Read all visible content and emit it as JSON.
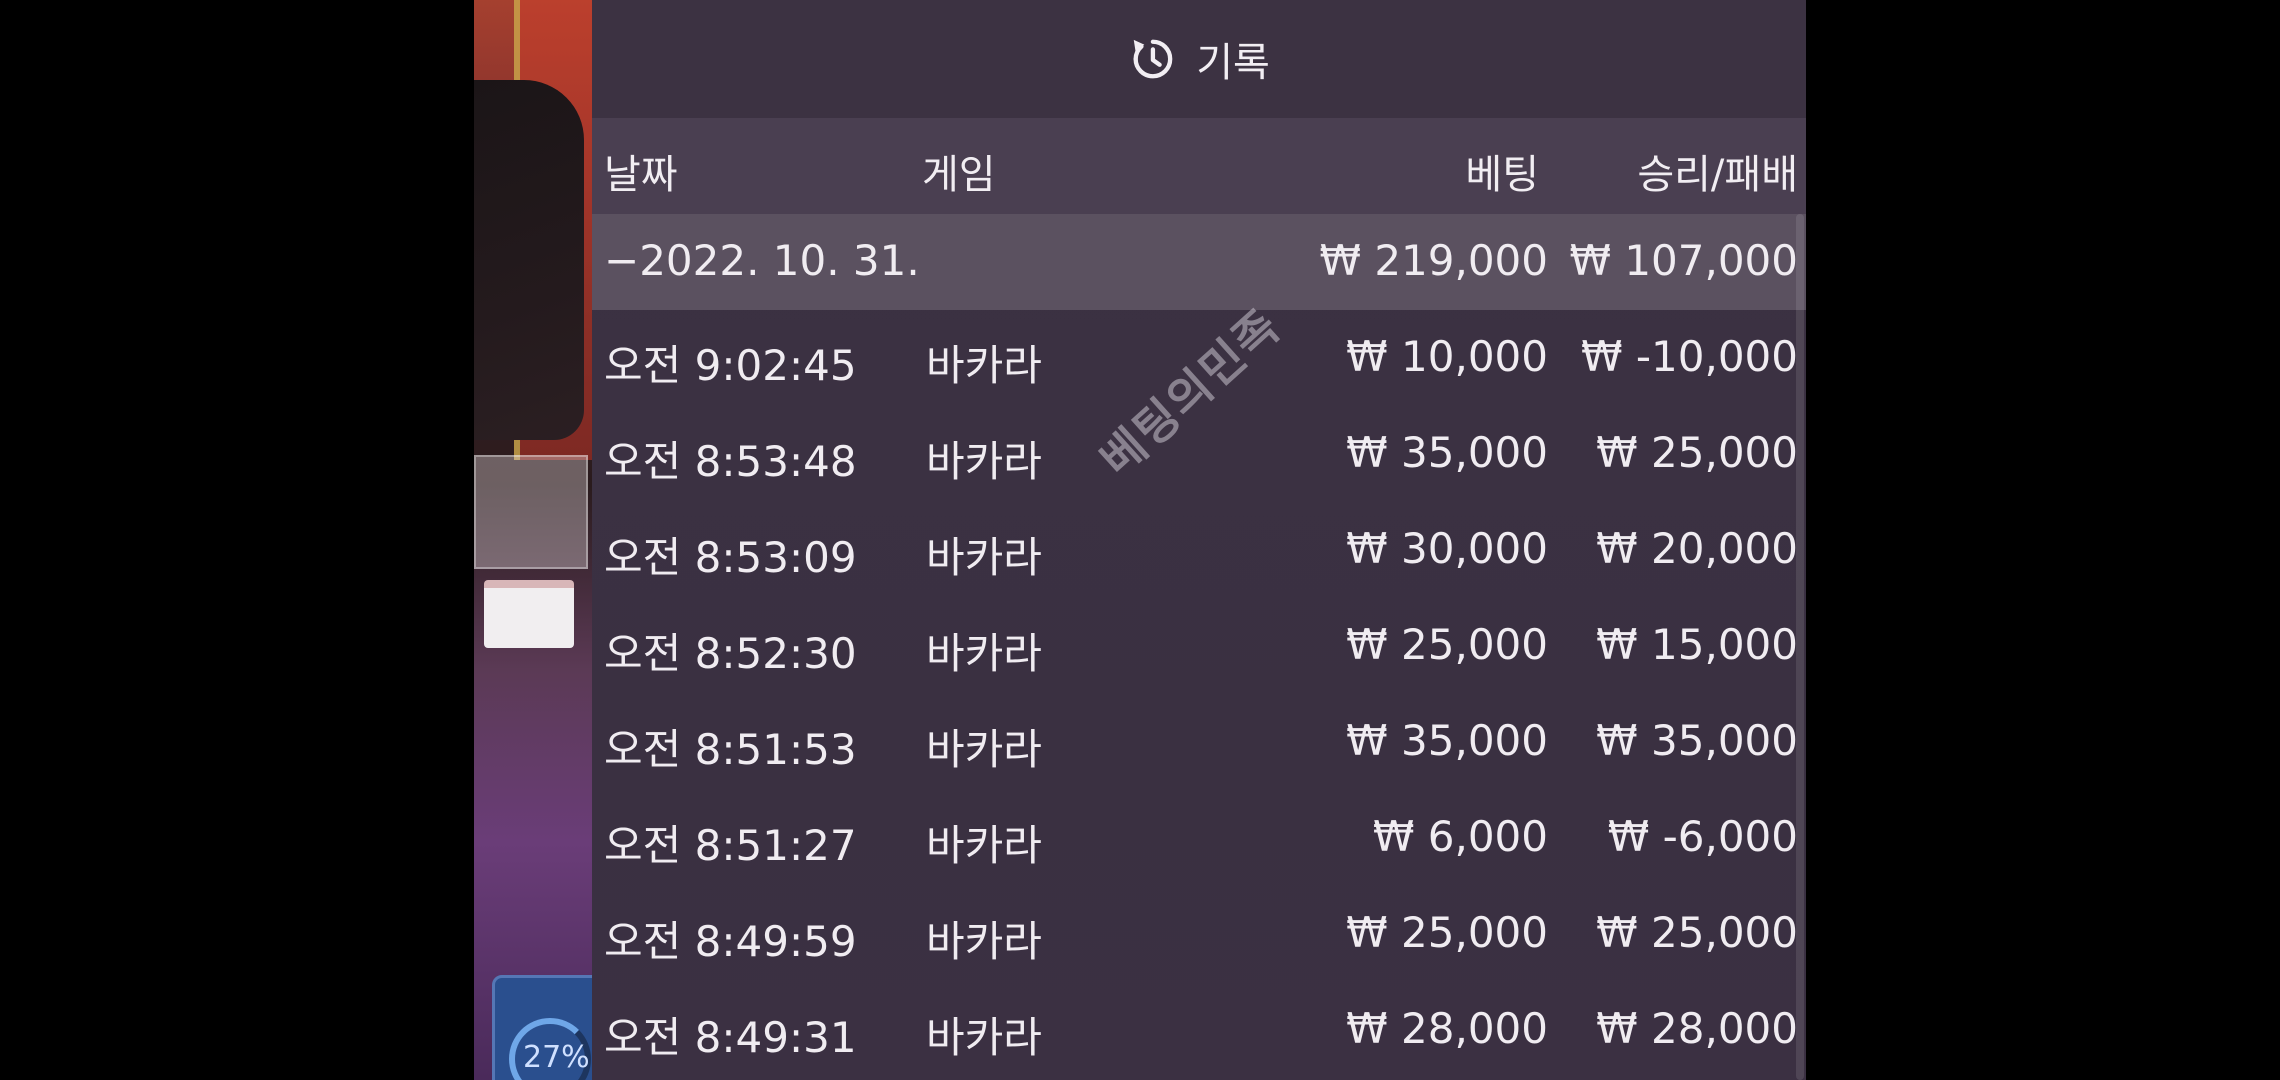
{
  "panel": {
    "title": "기록",
    "icon": "history-icon"
  },
  "columns": {
    "date": "날짜",
    "game": "게임",
    "bet": "베팅",
    "win_loss": "승리/패배"
  },
  "date_group": {
    "date": "−2022. 10. 31.",
    "total_bet": "₩ 219,000",
    "total_win_loss": "₩ 107,000"
  },
  "rows": [
    {
      "time": "오전 9:02:45",
      "game": "바카라",
      "bet": "₩ 10,000",
      "win_loss": "₩ -10,000"
    },
    {
      "time": "오전 8:53:48",
      "game": "바카라",
      "bet": "₩ 35,000",
      "win_loss": "₩ 25,000"
    },
    {
      "time": "오전 8:53:09",
      "game": "바카라",
      "bet": "₩ 30,000",
      "win_loss": "₩ 20,000"
    },
    {
      "time": "오전 8:52:30",
      "game": "바카라",
      "bet": "₩ 25,000",
      "win_loss": "₩ 15,000"
    },
    {
      "time": "오전 8:51:53",
      "game": "바카라",
      "bet": "₩ 35,000",
      "win_loss": "₩ 35,000"
    },
    {
      "time": "오전 8:51:27",
      "game": "바카라",
      "bet": "₩ 6,000",
      "win_loss": "₩ -6,000"
    },
    {
      "time": "오전 8:49:59",
      "game": "바카라",
      "bet": "₩ 25,000",
      "win_loss": "₩ 25,000"
    },
    {
      "time": "오전 8:49:31",
      "game": "바카라",
      "bet": "₩ 28,000",
      "win_loss": "₩ 28,000"
    }
  ],
  "watermark": "베팅의민족",
  "video": {
    "badge_text": "27%"
  },
  "colors": {
    "panel_bg": "#3a3040",
    "header_bg": "#4a3f51",
    "date_row_bg": "#5b5160",
    "text": "#f0ecf1"
  }
}
